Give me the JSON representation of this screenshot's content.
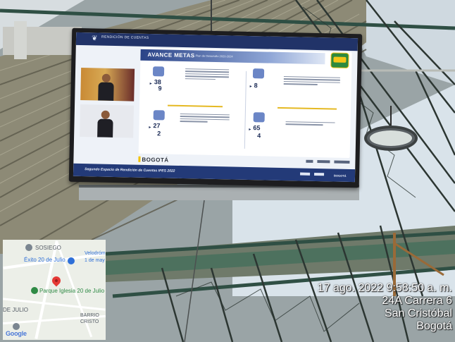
{
  "screen": {
    "header_brand": "RENDICIÓN DE CUENTAS",
    "panel_title": "AVANCE METAS",
    "panel_subtitle": "Plan de Desarrollo 2020-2024",
    "stats": [
      {
        "value": "38",
        "value2": "9"
      },
      {
        "value": "8",
        "value2": ""
      },
      {
        "value": "27",
        "value2": "2"
      },
      {
        "value": "65",
        "value2": "4"
      }
    ],
    "bogota_logo": "BOGOTÁ",
    "footer_text": "Segundo Espacio de Rendición de Cuentas IPES 2022",
    "footer_bogota_1": "BOGOTÁ",
    "footer_bogota_2": "BOGOTÁ"
  },
  "map": {
    "labels": {
      "sosiego": "SOSIEGO",
      "exito": "Éxito 20 de Julio",
      "velodromo": "Velodróm",
      "may": "1 de may",
      "parque": "Parque Iglesia 20 de Julio",
      "de_julio": "DE JULIO",
      "barrio": "BARRIO",
      "cristo": "CRISTO",
      "google": "Google"
    }
  },
  "timestamp": {
    "line1": "17 ago. 2022 9:58:50 a. m.",
    "line2": "24A Carrera 6",
    "line3": "San Cristóbal",
    "line4": "Bogotá"
  },
  "colors": {
    "tv_header": "#213368",
    "accent_yellow": "#e5b923",
    "pin_red": "#e53935"
  }
}
